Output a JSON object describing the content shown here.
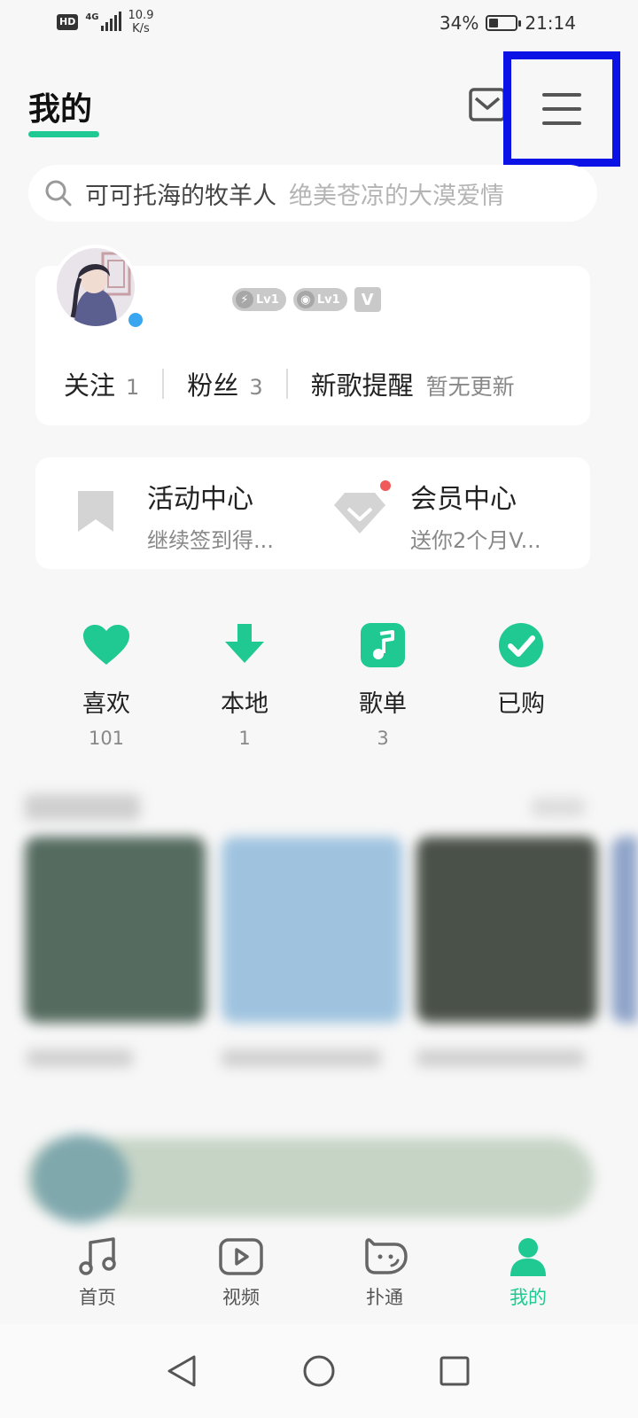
{
  "status_bar": {
    "hd_badge": "HD",
    "network_type": "4G",
    "network_speed_value": "10.9",
    "network_speed_unit": "K/s",
    "battery_percent": "34%",
    "battery_level": 0.34,
    "time": "21:14"
  },
  "header": {
    "title": "我的",
    "mail_icon": "mail-icon",
    "menu_icon": "hamburger-menu-icon"
  },
  "search": {
    "username": "可可托海的牧羊人",
    "hint": "绝美苍凉的大漠爱情"
  },
  "profile": {
    "badges": [
      {
        "glyph": "⚡",
        "level": "Lv1"
      },
      {
        "glyph": "◉",
        "level": "Lv1"
      }
    ],
    "vip_badge": "V",
    "stats": {
      "follow_label": "关注",
      "follow_count": "1",
      "fans_label": "粉丝",
      "fans_count": "3",
      "new_songs_label": "新歌提醒",
      "new_songs_hint": "暂无更新"
    }
  },
  "activities": [
    {
      "title": "活动中心",
      "subtitle": "继续签到得...",
      "icon": "bookmark-icon"
    },
    {
      "title": "会员中心",
      "subtitle": "送你2个月V...",
      "icon": "diamond-icon"
    }
  ],
  "quick_actions": [
    {
      "label": "喜欢",
      "count": "101",
      "icon": "heart-icon"
    },
    {
      "label": "本地",
      "count": "1",
      "icon": "download-icon"
    },
    {
      "label": "歌单",
      "count": "3",
      "icon": "music-note-icon"
    },
    {
      "label": "已购",
      "count": "",
      "icon": "check-circle-icon"
    }
  ],
  "bottom_nav": [
    {
      "label": "首页",
      "icon": "music-note-icon",
      "active": false
    },
    {
      "label": "视频",
      "icon": "play-icon",
      "active": false
    },
    {
      "label": "扑通",
      "icon": "smile-chat-icon",
      "active": false
    },
    {
      "label": "我的",
      "icon": "user-icon",
      "active": true
    }
  ],
  "colors": {
    "accent": "#1fc991",
    "highlight_box": "#0b12e6",
    "notification_dot": "#f05a5a",
    "background": "#f7f7f7"
  }
}
